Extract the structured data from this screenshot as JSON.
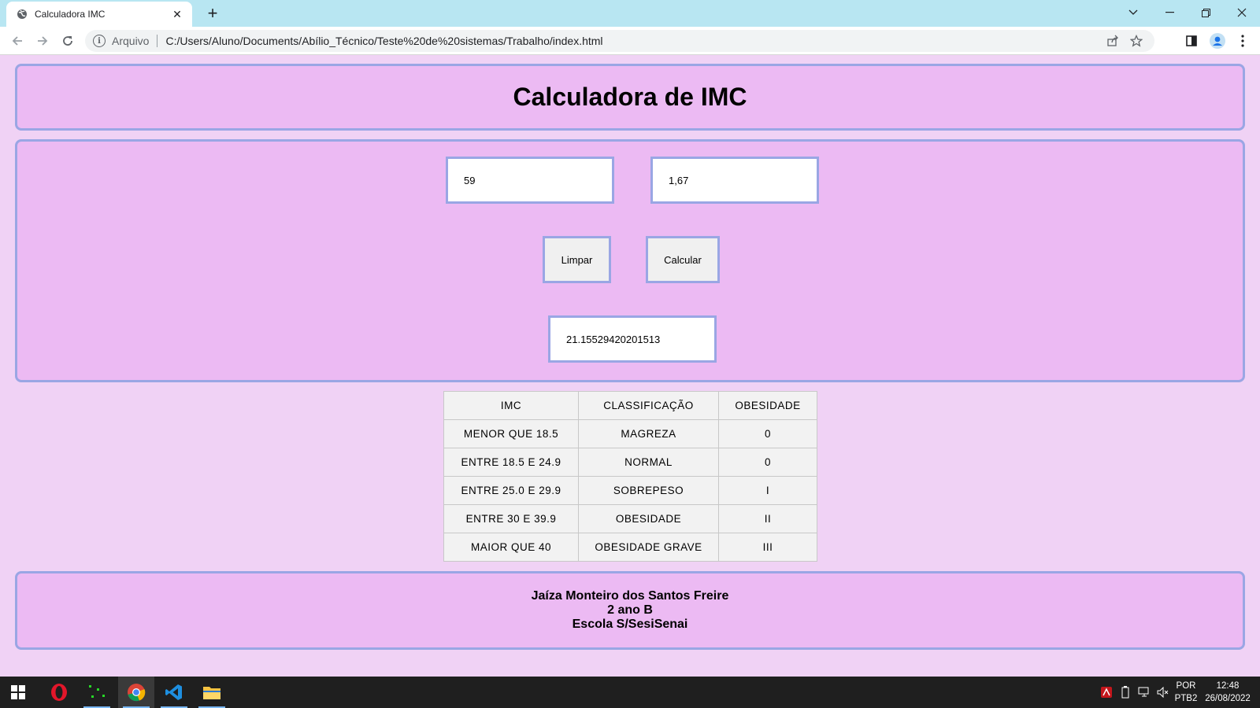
{
  "browser": {
    "tab_title": "Calculadora IMC",
    "new_tab": "+",
    "address_prefix": "Arquivo",
    "url": "C:/Users/Aluno/Documents/Abílio_Técnico/Teste%20de%20sistemas/Trabalho/index.html"
  },
  "page": {
    "title": "Calculadora de IMC",
    "weight_value": "59",
    "height_value": "1,67",
    "clear_label": "Limpar",
    "calc_label": "Calcular",
    "result_value": "21.15529420201513",
    "table": {
      "headers": [
        "IMC",
        "CLASSIFICAÇÃO",
        "OBESIDADE"
      ],
      "rows": [
        [
          "MENOR QUE 18.5",
          "MAGREZA",
          "0"
        ],
        [
          "ENTRE 18.5 E 24.9",
          "NORMAL",
          "0"
        ],
        [
          "ENTRE 25.0 E 29.9",
          "SOBREPESO",
          "I"
        ],
        [
          "ENTRE 30 E 39.9",
          "OBESIDADE",
          "II"
        ],
        [
          "MAIOR QUE 40",
          "OBESIDADE GRAVE",
          "III"
        ]
      ]
    },
    "footer": {
      "name": "Jaíza Monteiro dos Santos Freire",
      "class": "2 ano B",
      "school": "Escola S/SesiSenai"
    }
  },
  "taskbar": {
    "language_top": "POR",
    "language_bottom": "PTB2",
    "time": "12:48",
    "date": "26/08/2022"
  },
  "colors": {
    "page_background": "#f0d2f5",
    "panel_background": "#ecbaf3",
    "panel_border": "#9aa6e4",
    "tab_strip": "#b8e6f2"
  }
}
